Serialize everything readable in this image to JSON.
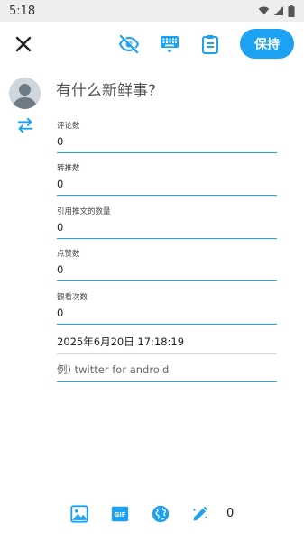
{
  "status_bar": {
    "time": "5:18"
  },
  "toolbar": {
    "save_label": "保持",
    "icons": [
      "close-icon",
      "visibility-off-icon",
      "keyboard-icon",
      "clipboard-icon"
    ]
  },
  "compose": {
    "placeholder": "有什么新鲜事?"
  },
  "fields": [
    {
      "label": "评论数",
      "value": "0"
    },
    {
      "label": "转推数",
      "value": "0"
    },
    {
      "label": "引用推文的数量",
      "value": "0"
    },
    {
      "label": "点赞数",
      "value": "0"
    },
    {
      "label": "觀看次数",
      "value": "0"
    }
  ],
  "datetime": "2025年6月20日 17:18:19",
  "via_placeholder": "例) twitter for android",
  "bottom_bar": {
    "icons": [
      "image-icon",
      "gif-icon",
      "globe-icon",
      "edit-sparkle-icon"
    ],
    "count": "0"
  },
  "colors": {
    "accent": "#1da1f2",
    "status_bar_bg": "#eeeeee"
  }
}
